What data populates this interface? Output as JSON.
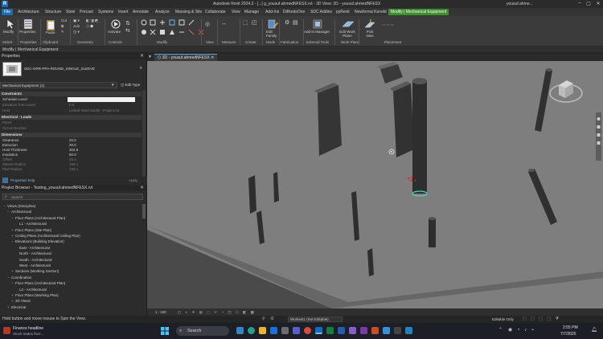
{
  "titlebar": {
    "title": "Autodesk Revit 2024.3 - [...] g_yousuf.ahmedNFESX.rvt - 3D View: 3D - yousuf.ahmedNFESX",
    "user": "yousuf.ahme..."
  },
  "ribbon_tabs": [
    "File",
    "Architecture",
    "Structure",
    "Steel",
    "Precast",
    "Systems",
    "Insert",
    "Annotate",
    "Analyze",
    "Massing & Site",
    "Collaborate",
    "View",
    "Manage",
    "Add-Ins",
    "DiRootsOne",
    "SDC Addins",
    "pyRevit",
    "Newforma Konekt",
    "Modify | Mechanical Equipment"
  ],
  "ribbon": {
    "buttons": {
      "modify": "Modify",
      "properties": "Properties",
      "clipboard_paste": "Paste",
      "cut": "Cut",
      "join": "Join",
      "activate": "Activate",
      "edit_family": "Edit Family",
      "add_manager": "Add-in Manager",
      "edit_workplane": "Edit Work Plane",
      "pick_new": "Pick New"
    },
    "groups": [
      "Select",
      "Properties",
      "Clipboard",
      "Geometry",
      "Controls",
      "Modify",
      "View",
      "Measure",
      "Create",
      "Mode",
      "Fabrication",
      "External Tools",
      "Work Plane",
      "Placement"
    ]
  },
  "context_bar": "Modify | Mechanical Equipment",
  "properties": {
    "header": "Properties",
    "type_name": "SDC-GRR-PPA-ROUND_SINGLE_SLEEVE",
    "selector": "Mechanical Equipment (1)",
    "edit_type": "Edit Type",
    "sections": {
      "constraints": "Constraints",
      "electrical": "Electrical - Loads",
      "dimensions": "Dimensions"
    },
    "constraints_rows": [
      {
        "k": "Schedule Level",
        "v": ""
      },
      {
        "k": "Elevation from Level",
        "v": "0.0"
      },
      {
        "k": "Host",
        "v": "Linked Revit Model : Project.rvt"
      }
    ],
    "electrical_rows": [
      {
        "k": "Panel",
        "v": ""
      },
      {
        "k": "Circuit Number",
        "v": ""
      }
    ],
    "dimension_rows": [
      {
        "k": "Clearance",
        "v": "20.0"
      },
      {
        "k": "Extrusion",
        "v": "20.0"
      },
      {
        "k": "Host Thickness",
        "v": "304.8"
      },
      {
        "k": "Insulation",
        "v": "50.0"
      },
      {
        "k": "Offset",
        "v": "25.4"
      },
      {
        "k": "Sleeve Radius",
        "v": "158.1"
      },
      {
        "k": "Pipe Radius",
        "v": "158.1"
      }
    ],
    "apply": "Apply",
    "help": "Properties help"
  },
  "browser": {
    "header": "Project Browser - Testing_yousuf.ahmedNFESX.rvt",
    "search_placeholder": "Search",
    "tree": [
      {
        "label": "Views (Discipline)",
        "level": 0,
        "toggle": "−"
      },
      {
        "label": "Architectural",
        "level": 1,
        "toggle": "−"
      },
      {
        "label": "Floor Plans (Architectural Plan)",
        "level": 2,
        "toggle": "−"
      },
      {
        "label": "L1 - Architectural",
        "level": 3,
        "toggle": ""
      },
      {
        "label": "Floor Plans (Site Plan)",
        "level": 2,
        "toggle": "+"
      },
      {
        "label": "Ceiling Plans (Architectural Ceiling Plan)",
        "level": 2,
        "toggle": "+"
      },
      {
        "label": "Elevations (Building Elevation)",
        "level": 2,
        "toggle": "−"
      },
      {
        "label": "East - Architectural",
        "level": 3,
        "toggle": ""
      },
      {
        "label": "North - Architectural",
        "level": 3,
        "toggle": ""
      },
      {
        "label": "South - Architectural",
        "level": 3,
        "toggle": ""
      },
      {
        "label": "West - Architectural",
        "level": 3,
        "toggle": ""
      },
      {
        "label": "Sections (Working Section)",
        "level": 2,
        "toggle": "+"
      },
      {
        "label": "Coordination",
        "level": 1,
        "toggle": "−"
      },
      {
        "label": "Floor Plans (Architectural Plan)",
        "level": 2,
        "toggle": "−"
      },
      {
        "label": "L2 - Architectural",
        "level": 3,
        "toggle": ""
      },
      {
        "label": "Floor Plans (Working Plan)",
        "level": 2,
        "toggle": "+"
      },
      {
        "label": "3D Views",
        "level": 2,
        "toggle": "+"
      },
      {
        "label": "Electrical",
        "level": 1,
        "toggle": "+"
      }
    ]
  },
  "view": {
    "tab_label": "3D - yousuf.ahmedNFESX",
    "scale": "1 : 100"
  },
  "status": {
    "hint": "Hold button and move mouse to Spin the View.",
    "workset": "Workset1 (Not Editable)",
    "editable": "Editable Only",
    "zero": ":0"
  },
  "taskbar": {
    "news_title": "Finance headline",
    "news_sub": "Stock trades fluct...",
    "search": "Search",
    "time": "2:55 PM",
    "date": "7/7/2025"
  },
  "colors": {
    "accent_green": "#3c8f2a",
    "file_blue": "#1b6ab5",
    "viewport_bg": "#7c7c7c",
    "solid_dark": "#3a3a3a"
  }
}
